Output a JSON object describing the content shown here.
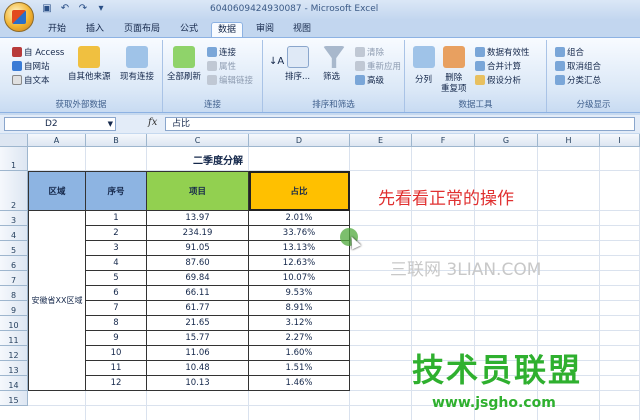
{
  "window": {
    "title": "6040609424930087 - Microsoft Excel"
  },
  "tabs": [
    "开始",
    "插入",
    "页面布局",
    "公式",
    "数据",
    "审阅",
    "视图"
  ],
  "active_tab": "数据",
  "ribbon": {
    "external": {
      "access": "自 Access",
      "web": "自网站",
      "text": "自文本",
      "other": "自其他来源",
      "existing": "现有连接",
      "label": "获取外部数据"
    },
    "connections": {
      "refresh": "全部刷新",
      "conn": "连接",
      "props": "属性",
      "edit": "编辑链接",
      "label": "连接"
    },
    "sort": {
      "sort_btn": "排序...",
      "filter": "筛选",
      "clear": "清除",
      "reapply": "重新应用",
      "advanced": "高级",
      "label": "排序和筛选"
    },
    "tools": {
      "split": "分列",
      "dedupe": "删除\n重复项",
      "validation": "数据有效性",
      "consolidate": "合并计算",
      "whatif": "假设分析",
      "label": "数据工具"
    },
    "outline": {
      "group": "组合",
      "ungroup": "取消组合",
      "subtotal": "分类汇总",
      "label": "分级显示"
    }
  },
  "formula": {
    "namebox": "D2",
    "fx": "fx",
    "content": "占比"
  },
  "columns": [
    "A",
    "B",
    "C",
    "D",
    "E",
    "F",
    "G",
    "H",
    "I"
  ],
  "rows": [
    "1",
    "2",
    "3",
    "4",
    "5",
    "6",
    "7",
    "8",
    "9",
    "10",
    "11",
    "12",
    "13",
    "14",
    "15"
  ],
  "sheet": {
    "title": "二季度分解",
    "headers": {
      "region": "区域",
      "seq": "序号",
      "item": "项目",
      "ratio": "占比"
    },
    "region_value": "安徽省XX区域",
    "data": [
      {
        "seq": "1",
        "item": "13.97",
        "ratio": "2.01%"
      },
      {
        "seq": "2",
        "item": "234.19",
        "ratio": "33.76%"
      },
      {
        "seq": "3",
        "item": "91.05",
        "ratio": "13.13%"
      },
      {
        "seq": "4",
        "item": "87.60",
        "ratio": "12.63%"
      },
      {
        "seq": "5",
        "item": "69.84",
        "ratio": "10.07%"
      },
      {
        "seq": "6",
        "item": "66.11",
        "ratio": "9.53%"
      },
      {
        "seq": "7",
        "item": "61.77",
        "ratio": "8.91%"
      },
      {
        "seq": "8",
        "item": "21.65",
        "ratio": "3.12%"
      },
      {
        "seq": "9",
        "item": "15.77",
        "ratio": "2.27%"
      },
      {
        "seq": "10",
        "item": "11.06",
        "ratio": "1.60%"
      },
      {
        "seq": "11",
        "item": "10.48",
        "ratio": "1.51%"
      },
      {
        "seq": "12",
        "item": "10.13",
        "ratio": "1.46%"
      }
    ]
  },
  "overlay": {
    "annotation": "先看看正常的操作",
    "watermark1": "三联网 3LIAN.COM",
    "watermark2": "技术员联盟",
    "watermark3": "www.jsgho.com"
  }
}
